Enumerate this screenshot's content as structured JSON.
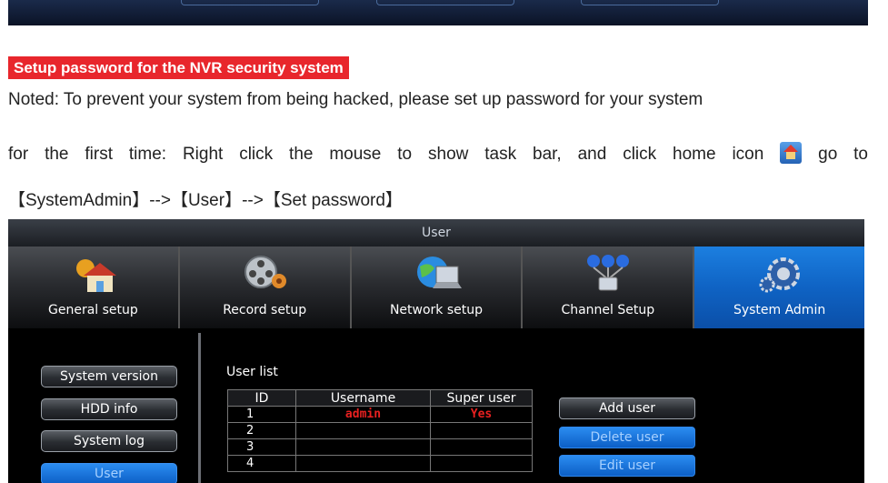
{
  "section_title": "Setup password for the NVR security system",
  "note_line": "Noted: To prevent your system from being hacked, please set up password for your system",
  "instruction_line_a": "for the first time: Right click the mouse to show task bar, and click home icon",
  "instruction_line_b": "go to",
  "path_line": "【SystemAdmin】-->【User】-->【Set password】",
  "inline_icon": "home-icon",
  "nvr": {
    "window_title": "User",
    "tabs": [
      {
        "label": "General setup",
        "icon": "house-gear-icon"
      },
      {
        "label": "Record setup",
        "icon": "film-reel-icon"
      },
      {
        "label": "Network setup",
        "icon": "globe-laptop-icon"
      },
      {
        "label": "Channel Setup",
        "icon": "network-nodes-icon"
      },
      {
        "label": "System Admin",
        "icon": "gears-icon"
      }
    ],
    "active_tab": "System Admin",
    "sidebar": [
      {
        "label": "System version"
      },
      {
        "label": "HDD info"
      },
      {
        "label": "System log"
      },
      {
        "label": "User"
      }
    ],
    "active_sidebar": "User",
    "user_list_label": "User list",
    "table": {
      "headers": [
        "ID",
        "Username",
        "Super user"
      ],
      "rows": [
        [
          "1",
          "admin",
          "Yes"
        ],
        [
          "2",
          "",
          ""
        ],
        [
          "3",
          "",
          ""
        ],
        [
          "4",
          "",
          ""
        ]
      ]
    },
    "actions": [
      "Add user",
      "Delete user",
      "Edit user"
    ]
  },
  "colors": {
    "title_red": "#e8262c",
    "active_blue": "#1271d6",
    "table_highlight": "#e82020"
  }
}
